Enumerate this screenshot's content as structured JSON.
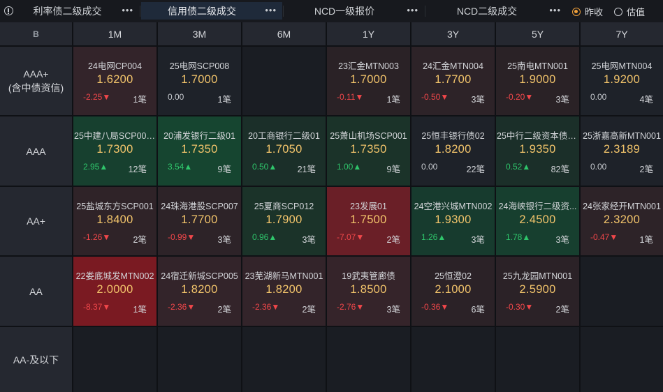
{
  "tabs": [
    {
      "label": "利率债二级成交",
      "more": "•••",
      "active": false
    },
    {
      "label": "信用债二级成交",
      "more": "•••",
      "active": true
    },
    {
      "label": "NCD一级报价",
      "more": "•••",
      "active": false
    },
    {
      "label": "NCD二级成交",
      "more": "•••",
      "active": false
    }
  ],
  "radios": [
    {
      "label": "昨收",
      "checked": true
    },
    {
      "label": "估值",
      "checked": false
    }
  ],
  "corner_label": "B",
  "columns": [
    "1M",
    "3M",
    "6M",
    "1Y",
    "3Y",
    "5Y",
    "7Y"
  ],
  "rows": [
    {
      "label": "AAA+\n(含中债资信)",
      "cells": [
        {
          "name": "24电网CP004",
          "yield": "1.6200",
          "change": "-2.25▼",
          "dir": "down",
          "count": "1笔",
          "bg": "#33242a"
        },
        {
          "name": "25电网SCP008",
          "yield": "1.7000",
          "change": "0.00",
          "dir": "flat",
          "count": "1笔",
          "bg": "#1e2229"
        },
        null,
        {
          "name": "23汇金MTN003",
          "yield": "1.7000",
          "change": "-0.11▼",
          "dir": "down",
          "count": "1笔",
          "bg": "#2a2226"
        },
        {
          "name": "24汇金MTN004",
          "yield": "1.7700",
          "change": "-0.50▼",
          "dir": "down",
          "count": "3笔",
          "bg": "#2d2328"
        },
        {
          "name": "25南电MTN001",
          "yield": "1.9000",
          "change": "-0.20▼",
          "dir": "down",
          "count": "3笔",
          "bg": "#2a2226"
        },
        {
          "name": "25电网MTN004",
          "yield": "1.9200",
          "change": "0.00",
          "dir": "flat",
          "count": "4笔",
          "bg": "#1e2229"
        }
      ]
    },
    {
      "label": "AAA",
      "cells": [
        {
          "name": "25中建八局SCP007...",
          "yield": "1.7300",
          "change": "2.95▲",
          "dir": "up",
          "count": "12笔",
          "bg": "#17402f"
        },
        {
          "name": "20浦发银行二级01",
          "yield": "1.7350",
          "change": "3.54▲",
          "dir": "up",
          "count": "9笔",
          "bg": "#164530"
        },
        {
          "name": "20工商银行二级01",
          "yield": "1.7050",
          "change": "0.50▲",
          "dir": "up",
          "count": "21笔",
          "bg": "#1b2f29"
        },
        {
          "name": "25萧山机场SCP001",
          "yield": "1.7350",
          "change": "1.00▲",
          "dir": "up",
          "count": "9笔",
          "bg": "#1b3329"
        },
        {
          "name": "25恒丰银行债02",
          "yield": "1.8200",
          "change": "0.00",
          "dir": "flat",
          "count": "22笔",
          "bg": "#1e2229"
        },
        {
          "name": "25中行二级资本债0...",
          "yield": "1.9350",
          "change": "0.52▲",
          "dir": "up",
          "count": "82笔",
          "bg": "#1b2f29"
        },
        {
          "name": "25浙嘉高新MTN001",
          "yield": "2.3189",
          "change": "0.00",
          "dir": "flat",
          "count": "2笔",
          "bg": "#1e2229"
        }
      ]
    },
    {
      "label": "AA+",
      "cells": [
        {
          "name": "25盐城东方SCP001",
          "yield": "1.8400",
          "change": "-1.26▼",
          "dir": "down",
          "count": "2笔",
          "bg": "#2f2328"
        },
        {
          "name": "24珠海港股SCP007",
          "yield": "1.7700",
          "change": "-0.99▼",
          "dir": "down",
          "count": "3笔",
          "bg": "#2d2328"
        },
        {
          "name": "25夏商SCP012",
          "yield": "1.7900",
          "change": "0.96▲",
          "dir": "up",
          "count": "3笔",
          "bg": "#1b3329"
        },
        {
          "name": "23发展01",
          "yield": "1.7500",
          "change": "-7.07▼",
          "dir": "down",
          "count": "2笔",
          "bg": "#6a1f27"
        },
        {
          "name": "24空港兴城MTN002",
          "yield": "1.9300",
          "change": "1.26▲",
          "dir": "up",
          "count": "3笔",
          "bg": "#173b2e"
        },
        {
          "name": "24海峡银行二级资...",
          "yield": "2.4500",
          "change": "1.78▲",
          "dir": "up",
          "count": "3笔",
          "bg": "#173f2f"
        },
        {
          "name": "24张家经开MTN001",
          "yield": "2.3200",
          "change": "-0.47▼",
          "dir": "down",
          "count": "1笔",
          "bg": "#2d2328"
        }
      ]
    },
    {
      "label": "AA",
      "cells": [
        {
          "name": "22娄底城发MTN002",
          "yield": "2.0000",
          "change": "-8.37▼",
          "dir": "down",
          "count": "1笔",
          "bg": "#7a1a22"
        },
        {
          "name": "24宿迁新城SCP005",
          "yield": "1.8200",
          "change": "-2.36▼",
          "dir": "down",
          "count": "2笔",
          "bg": "#33242a"
        },
        {
          "name": "23芜湖新马MTN001",
          "yield": "1.8200",
          "change": "-2.36▼",
          "dir": "down",
          "count": "2笔",
          "bg": "#33242a"
        },
        {
          "name": "19武夷管廊债",
          "yield": "1.8500",
          "change": "-2.76▼",
          "dir": "down",
          "count": "3笔",
          "bg": "#35242a"
        },
        {
          "name": "25恒澄02",
          "yield": "2.1000",
          "change": "-0.36▼",
          "dir": "down",
          "count": "6笔",
          "bg": "#2b2227"
        },
        {
          "name": "25九龙园MTN001",
          "yield": "2.5900",
          "change": "-0.30▼",
          "dir": "down",
          "count": "2笔",
          "bg": "#2b2227"
        },
        null
      ]
    },
    {
      "label": "AA-及以下",
      "cells": [
        null,
        null,
        null,
        null,
        null,
        null,
        null
      ]
    }
  ]
}
